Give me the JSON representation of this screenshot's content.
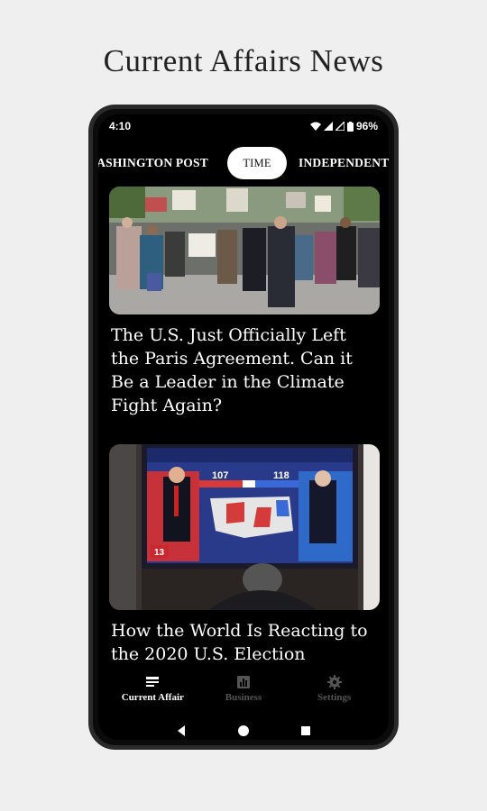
{
  "title": "Current Affairs News",
  "status": {
    "time": "4:10",
    "battery": "96%"
  },
  "sources": [
    "WASHINGTON POST",
    "TIME",
    "INDEPENDENT"
  ],
  "active_source": "TIME",
  "articles": [
    {
      "headline": "The U.S. Just Officially Left the Paris Agreement. Can it Be a Leader in the Climate Fight Again?"
    },
    {
      "headline": "How the World Is Reacting to the 2020 U.S. Election"
    }
  ],
  "tv_overlay": {
    "left_score": "107",
    "right_score": "118",
    "channel": "13"
  },
  "bottom_nav": [
    {
      "label": "Current Affair",
      "icon": "news-icon",
      "active": true
    },
    {
      "label": "Business",
      "icon": "chart-icon",
      "active": false
    },
    {
      "label": "Settings",
      "icon": "gear-icon",
      "active": false
    }
  ],
  "system_nav": [
    "back-icon",
    "home-icon",
    "recents-icon"
  ],
  "colors": {
    "background": "#efefef",
    "screen": "#000000",
    "active_tab": "#ffffff",
    "inactive_nav": "#555555"
  }
}
